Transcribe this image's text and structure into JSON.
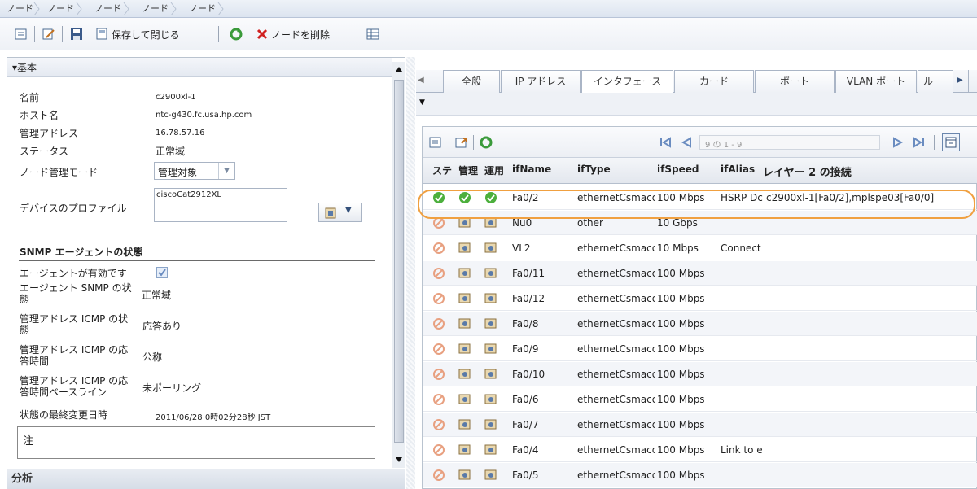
{
  "breadcrumb": [
    "ノード",
    "ノード",
    "ノード",
    "ノード",
    "ノード"
  ],
  "toolbar": {
    "save_close_label": "保存して閉じる",
    "delete_label": "ノードを削除"
  },
  "left": {
    "section_title": "▾基本",
    "fields": {
      "name_label": "名前",
      "name_value": "c2900xl-1",
      "host_label": "ホスト名",
      "host_value": "ntc-g430.fc.usa.hp.com",
      "mgmt_addr_label": "管理アドレス",
      "mgmt_addr_value": "16.78.57.16",
      "status_label": "ステータス",
      "status_value": "正常域",
      "mode_label": "ノード管理モード",
      "mode_value": "管理対象",
      "profile_label": "デバイスのプロファイル",
      "profile_value": "ciscoCat2912XL"
    },
    "snmp_title": "SNMP エージェントの状態",
    "snmp": {
      "agent_enabled_label": "エージェントが有効です",
      "agent_snmp_label_1": "エージェント SNMP の状",
      "agent_snmp_label_2": "態",
      "agent_snmp_value": "正常域",
      "icmp_state_label_1": "管理アドレス ICMP の状",
      "icmp_state_label_2": "態",
      "icmp_state_value": "応答あり",
      "icmp_resp_label_1": "管理アドレス ICMP の応",
      "icmp_resp_label_2": "答時間",
      "icmp_resp_value": "公称",
      "icmp_base_label_1": "管理アドレス ICMP の応",
      "icmp_base_label_2": "答時間ベースライン",
      "icmp_base_value": "未ポーリング",
      "last_change_label": "状態の最終変更日時",
      "last_change_value": "2011/06/28 0時02分28秒 JST"
    },
    "note_label": "注"
  },
  "analysis_title": "分析",
  "tabs": [
    "全般",
    "IP アドレス",
    "インタフェース",
    "カード",
    "ポート",
    "VLAN ポート",
    "ル"
  ],
  "active_tab": "インタフェース",
  "table": {
    "pagination": "9 の 1 - 9",
    "headers": [
      "ステ",
      "管理",
      "運用",
      "ifName",
      "ifType",
      "ifSpeed",
      "ifAlias",
      "レイヤー 2 の接続"
    ],
    "rows": [
      {
        "name": "Fa0/2",
        "type": "ethernetCsmacd",
        "speed": "100 Mbps",
        "alias": "HSRP Dc",
        "l2": "c2900xl-1[Fa0/2],mplspe03[Fa0/0]",
        "ok": true
      },
      {
        "name": "Nu0",
        "type": "other",
        "speed": "10 Gbps",
        "alias": "",
        "l2": "",
        "ok": false
      },
      {
        "name": "VL2",
        "type": "ethernetCsmacd",
        "speed": "10 Mbps",
        "alias": "Connect",
        "l2": "",
        "ok": false
      },
      {
        "name": "Fa0/11",
        "type": "ethernetCsmacd",
        "speed": "100 Mbps",
        "alias": "",
        "l2": "",
        "ok": false
      },
      {
        "name": "Fa0/12",
        "type": "ethernetCsmacd",
        "speed": "100 Mbps",
        "alias": "",
        "l2": "",
        "ok": false
      },
      {
        "name": "Fa0/8",
        "type": "ethernetCsmacd",
        "speed": "100 Mbps",
        "alias": "",
        "l2": "",
        "ok": false
      },
      {
        "name": "Fa0/9",
        "type": "ethernetCsmacd",
        "speed": "100 Mbps",
        "alias": "",
        "l2": "",
        "ok": false
      },
      {
        "name": "Fa0/10",
        "type": "ethernetCsmacd",
        "speed": "100 Mbps",
        "alias": "",
        "l2": "",
        "ok": false
      },
      {
        "name": "Fa0/6",
        "type": "ethernetCsmacd",
        "speed": "100 Mbps",
        "alias": "",
        "l2": "",
        "ok": false
      },
      {
        "name": "Fa0/7",
        "type": "ethernetCsmacd",
        "speed": "100 Mbps",
        "alias": "",
        "l2": "",
        "ok": false
      },
      {
        "name": "Fa0/4",
        "type": "ethernetCsmacd",
        "speed": "100 Mbps",
        "alias": "Link to e",
        "l2": "",
        "ok": false
      },
      {
        "name": "Fa0/5",
        "type": "ethernetCsmacd",
        "speed": "100 Mbps",
        "alias": "",
        "l2": "",
        "ok": false
      }
    ]
  },
  "colors": {
    "ok": "#4caf3c",
    "highlight": "#f0a040",
    "disabled": "#e8a080"
  }
}
